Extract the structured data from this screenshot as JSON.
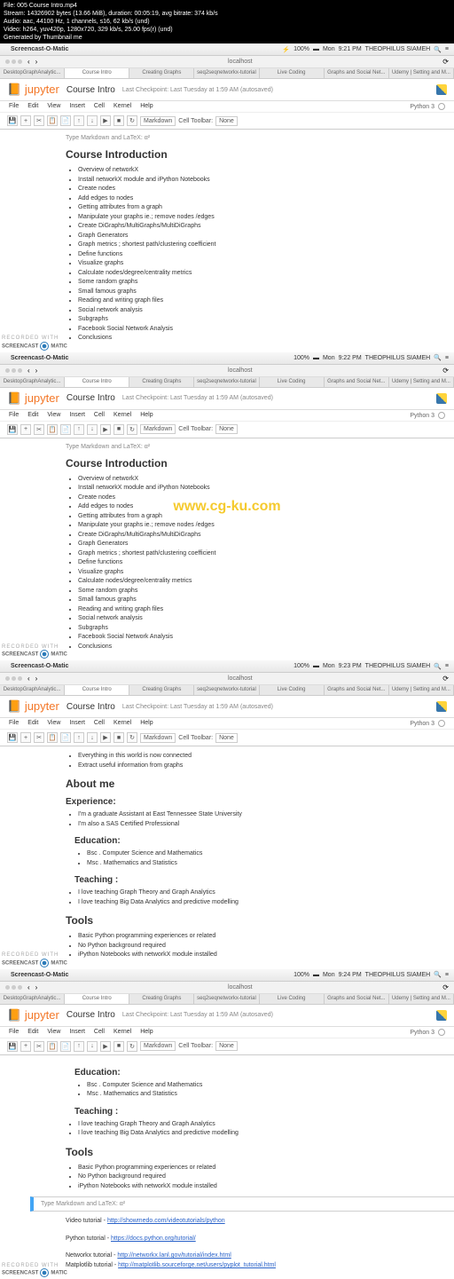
{
  "terminal": {
    "l1": "File: 005 Course Intro.mp4",
    "l2": "Stream: 14326902 bytes (13.66 MiB), duration: 00:05:19, avg bitrate: 374 kb/s",
    "l3": "Audio: aac, 44100 Hz, 1 channels, s16, 62 kb/s (und)",
    "l4": "Video: h264, yuv420p, 1280x720, 329 kb/s, 25.00 fps(r) (und)",
    "l5": "Generated by Thumbnail me"
  },
  "menubar": {
    "appname": "Screencast-O-Matic",
    "battery": "100%",
    "user": "THEOPHILUS SIAMEH",
    "day": "Mon"
  },
  "times": [
    "9:21 PM",
    "9:22 PM",
    "9:23 PM",
    "9:24 PM"
  ],
  "browser": {
    "url": "localhost"
  },
  "tabs": [
    "DesktopGraphAnalytic...",
    "Course Intro",
    "Creating Graphs",
    "seq2seqnetworkx-tutorial",
    "Live Coding",
    "Graphs and Social Net...",
    "Udemy | Setting and M..."
  ],
  "jupyter": {
    "logo": "jupyter",
    "title": "Course Intro",
    "checkpoint": "Last Checkpoint: Last Tuesday at 1:59 AM (autosaved)",
    "menus": [
      "File",
      "Edit",
      "View",
      "Insert",
      "Cell",
      "Kernel",
      "Help"
    ],
    "kernel": "Python 3",
    "celltype": "Markdown",
    "celltoolbar_label": "Cell Toolbar:",
    "celltoolbar_value": "None",
    "mdprompt": "Type Markdown and LaTeX: α²"
  },
  "course": {
    "heading": "Course Introduction",
    "items": [
      "Overview of networkX",
      "Install networkX module and iPython Notebooks",
      "Create nodes",
      "Add edges to nodes",
      "Getting attributes from a graph",
      "Manipulate your graphs ie.; remove nodes /edges",
      "Create DiGraphs/MultiGraphs/MultiDiGraphs",
      "Graph Generators",
      "Graph metrics ; shortest path/clustering coefficient",
      "Define functions",
      "Visualize graphs",
      "Calculate nodes/degree/centrality metrics",
      "Some random graphs",
      "Small famous graphs",
      "Reading and writing graph files",
      "Social network analysis",
      "Subgraphs",
      "Facebook Social Network Analysis",
      "Conclusions"
    ]
  },
  "p3top": [
    "Everything in this world is now connected",
    "Extract useful information from graphs"
  ],
  "about": {
    "heading": "About me",
    "exp_h": "Experience:",
    "exp": [
      "I'm a graduate Assistant at East Tennessee State University",
      "I'm also a SAS Certified Professional"
    ],
    "edu_h": "Education:",
    "edu": [
      "Bsc . Computer Science and Mathematics",
      "Msc . Mathematics and Statistics"
    ],
    "teach_h": "Teaching :",
    "teach": [
      "I love teaching Graph Theory and Graph Analytics",
      "I love teaching Big Data Analytics and predictive modelling"
    ],
    "tools_h": "Tools",
    "tools": [
      "Basic Python programming experiences or related",
      "No Python background required",
      "iPython Notebooks with networkX module installed"
    ]
  },
  "links": {
    "videolabel": "Video tutorial - ",
    "videourl": "http://showmedo.com/videotutorials/python",
    "pylabel": "Python tutorial - ",
    "pyurl": "https://docs.python.org/tutorial/",
    "nxlabel": "Networkx tutorial - ",
    "nxurl": "http://networkx.lanl.gov/tutorial/index.html",
    "mpllabel": "Matplotlib tutorial - ",
    "mplurl": "http://matplotlib.sourceforge.net/users/pyplot_tutorial.html"
  },
  "watermark": {
    "l1": "RECORDED WITH",
    "l2": "SCREENCAST",
    "l3": "MATIC"
  },
  "centerwm": "www.cg-ku.com"
}
